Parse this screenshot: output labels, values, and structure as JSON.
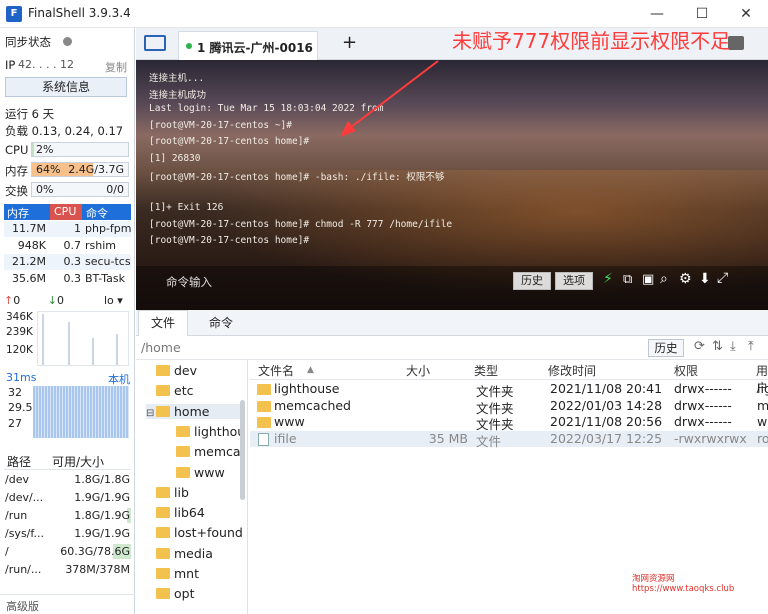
{
  "window": {
    "title": "FinalShell 3.9.3.4"
  },
  "sidebar": {
    "sync_label": "同步状态",
    "ip_label": "IP",
    "ip_value": "42.  .  .  . 12",
    "copy_label": "复制",
    "sysinfo_button": "系统信息",
    "uptime": "运行 6 天",
    "load": "负载 0.13, 0.24, 0.17",
    "cpu": {
      "label": "CPU",
      "text": "2%",
      "fraction": 0.02
    },
    "mem": {
      "label": "内存",
      "percent_text": "64%",
      "usage_text": "2.4G/3.7G",
      "fraction": 0.64
    },
    "swap": {
      "label": "交换",
      "percent_text": "0%",
      "usage_text": "0/0",
      "fraction": 0
    },
    "proc_headers": [
      "内存",
      "CPU",
      "命令"
    ],
    "processes": [
      {
        "mem": "11.7M",
        "cpu": "1",
        "cmd": "php-fpm"
      },
      {
        "mem": "948K",
        "cpu": "0.7",
        "cmd": "rshim"
      },
      {
        "mem": "21.2M",
        "cpu": "0.3",
        "cmd": "secu-tcs"
      },
      {
        "mem": "35.6M",
        "cpu": "0.3",
        "cmd": "BT-Task"
      }
    ],
    "net": {
      "up": "0",
      "down": "0",
      "iface": "lo",
      "ticks": [
        "346K",
        "239K",
        "120K"
      ]
    },
    "ping": {
      "ms_label": "31ms",
      "host_label": "本机",
      "ticks": [
        "32",
        "29.5",
        "27"
      ]
    },
    "disk_headers": [
      "路径",
      "可用/大小"
    ],
    "disks": [
      {
        "path": "/dev",
        "size": "1.8G/1.8G",
        "fraction": 0
      },
      {
        "path": "/dev/...",
        "size": "1.9G/1.9G",
        "fraction": 0
      },
      {
        "path": "/run",
        "size": "1.8G/1.9G",
        "fraction": 0.05
      },
      {
        "path": "/sys/f...",
        "size": "1.9G/1.9G",
        "fraction": 0
      },
      {
        "path": "/",
        "size": "60.3G/78.6G",
        "fraction": 0.23
      },
      {
        "path": "/run/...",
        "size": "378M/378M",
        "fraction": 0
      }
    ],
    "advanced_label": "高级版"
  },
  "tabs": {
    "active_tab": "1 腾讯云-广州-0016",
    "add": "+"
  },
  "annotation": "未赋予777权限前显示权限不足",
  "terminal": {
    "lines": [
      "连接主机...",
      "连接主机成功",
      "Last login: Tue Mar 15 18:03:04 2022 from",
      "[root@VM-20-17-centos ~]#",
      "[root@VM-20-17-centos home]#",
      "[1] 26830",
      "[root@VM-20-17-centos home]# -bash: ./ifile: 权限不够",
      "",
      "[1]+  Exit 126",
      "[root@VM-20-17-centos home]# chmod -R 777 /home/ifile",
      "[root@VM-20-17-centos home]#"
    ],
    "cmd_placeholder": "命令输入",
    "history_button": "历史",
    "options_button": "选项"
  },
  "files": {
    "tabs": [
      "文件",
      "命令"
    ],
    "path": "/home",
    "history_button": "历史",
    "tree": [
      "dev",
      "etc",
      "home",
      "lighthouse",
      "memcached",
      "www",
      "lib",
      "lib64",
      "lost+found",
      "media",
      "mnt",
      "opt"
    ],
    "columns": [
      "文件名",
      "大小",
      "类型",
      "修改时间",
      "权限",
      "用户"
    ],
    "rows": [
      {
        "name": "lighthouse",
        "size": "",
        "type": "文件夹",
        "mtime": "2021/11/08 20:41",
        "perm": "drwx------",
        "user": "lig"
      },
      {
        "name": "memcached",
        "size": "",
        "type": "文件夹",
        "mtime": "2022/01/03 14:28",
        "perm": "drwx------",
        "user": "m"
      },
      {
        "name": "www",
        "size": "",
        "type": "文件夹",
        "mtime": "2021/11/08 20:56",
        "perm": "drwx------",
        "user": "w"
      },
      {
        "name": "ifile",
        "size": "35 MB",
        "type": "文件",
        "mtime": "2022/03/17 12:25",
        "perm": "-rwxrwxrwx",
        "user": "ro"
      }
    ]
  },
  "watermark": {
    "line1": "淘网资源网",
    "line2": "https://www.taoqks.club"
  },
  "colors": {
    "accent": "#1e6fd9",
    "annotation": "#ff3b3b",
    "mem_fill": "#f8c08a",
    "cpu_fill": "#bfe3bf"
  }
}
